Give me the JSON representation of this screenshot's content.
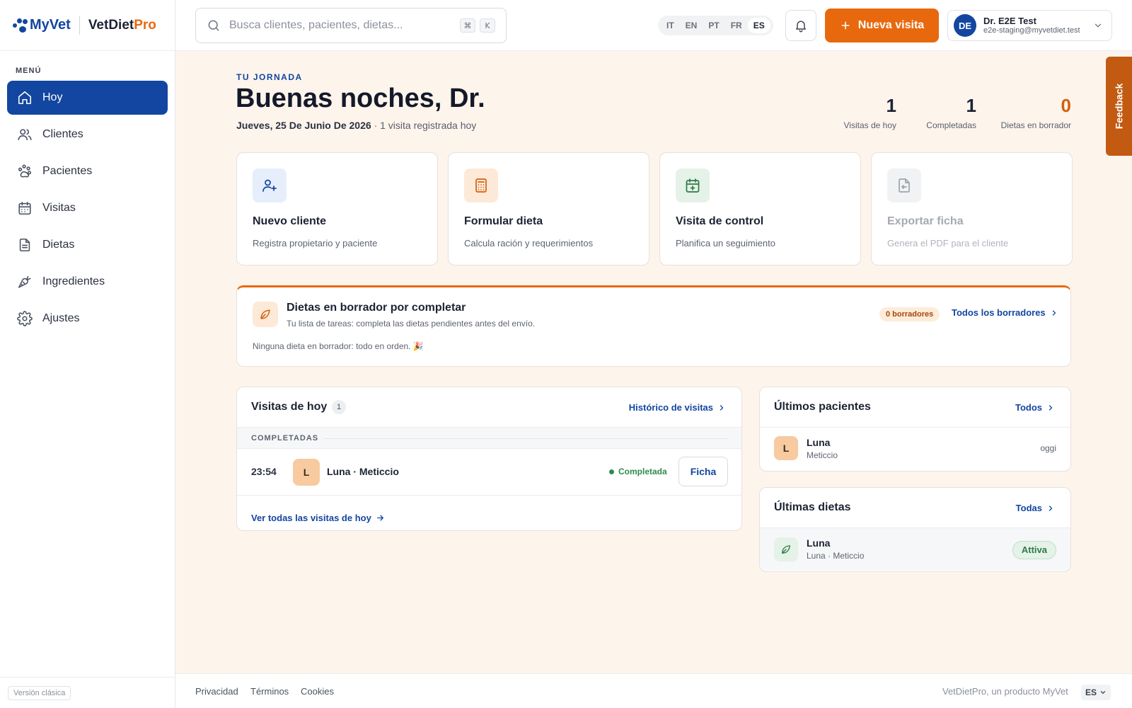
{
  "brand": {
    "name": "MyVet",
    "product_main": "VetDiet",
    "product_accent": "Pro"
  },
  "sidebar": {
    "menu_label": "MENÚ",
    "items": [
      {
        "label": "Hoy",
        "icon": "home-icon",
        "active": true
      },
      {
        "label": "Clientes",
        "icon": "users-icon"
      },
      {
        "label": "Pacientes",
        "icon": "paw-icon"
      },
      {
        "label": "Visitas",
        "icon": "calendar-icon"
      },
      {
        "label": "Dietas",
        "icon": "document-icon"
      },
      {
        "label": "Ingredientes",
        "icon": "carrot-icon"
      },
      {
        "label": "Ajustes",
        "icon": "gear-icon"
      }
    ],
    "classic_version": "Versión clásica"
  },
  "header": {
    "search_placeholder": "Busca clientes, pacientes, dietas...",
    "kbd_cmd": "⌘",
    "kbd_k": "K",
    "languages": [
      "IT",
      "EN",
      "PT",
      "FR",
      "ES"
    ],
    "active_language": "ES",
    "new_visit_label": "Nueva visita",
    "user": {
      "initials": "DE",
      "name": "Dr. E2E Test",
      "email": "e2e-staging@myvetdiet.test"
    }
  },
  "feedback_label": "Feedback",
  "day": {
    "eyebrow": "TU JORNADA",
    "greeting": "Buenas noches, Dr.",
    "date": "Jueves, 25 De Junio De 2026",
    "date_suffix": "· 1 visita registrada hoy",
    "stats": [
      {
        "value": "1",
        "label": "Visitas de hoy"
      },
      {
        "value": "1",
        "label": "Completadas"
      },
      {
        "value": "0",
        "label": "Dietas en borrador",
        "accent": "#d1610f"
      }
    ]
  },
  "actions": [
    {
      "title": "Nuevo cliente",
      "desc": "Registra propietario y paciente",
      "icon": "user-plus-icon"
    },
    {
      "title": "Formular dieta",
      "desc": "Calcula ración y requerimientos",
      "icon": "calculator-icon"
    },
    {
      "title": "Visita de control",
      "desc": "Planifica un seguimiento",
      "icon": "calendar-plus-icon"
    },
    {
      "title": "Exportar ficha",
      "desc": "Genera el PDF para el cliente",
      "icon": "file-export-icon",
      "disabled": true
    }
  ],
  "drafts": {
    "title": "Dietas en borrador por completar",
    "subtitle": "Tu lista de tareas: completa las dietas pendientes antes del envío.",
    "badge": "0 borradores",
    "link": "Todos los borradores",
    "empty": "Ninguna dieta en borrador: todo en orden. 🎉"
  },
  "visits": {
    "title": "Visitas de hoy",
    "count": "1",
    "history_link": "Histórico de visitas",
    "section": "COMPLETADAS",
    "rows": [
      {
        "time": "23:54",
        "initial": "L",
        "name": "Luna · Meticcio",
        "status": "Completada",
        "action": "Ficha"
      }
    ],
    "footer_link": "Ver todas las visitas de hoy"
  },
  "patients": {
    "title": "Últimos pacientes",
    "link": "Todos",
    "rows": [
      {
        "initial": "L",
        "name": "Luna",
        "breed": "Meticcio",
        "meta": "oggi"
      }
    ]
  },
  "diets": {
    "title": "Últimas dietas",
    "link": "Todas",
    "rows": [
      {
        "name": "Luna",
        "sub": "Luna · Meticcio",
        "status": "Attiva"
      }
    ]
  },
  "footer": {
    "links": [
      "Privacidad",
      "Términos",
      "Cookies"
    ],
    "brand_text": "VetDietPro, un producto MyVet",
    "lang": "ES"
  },
  "colors": {
    "primary": "#1346a0",
    "accent": "#e8690d",
    "success": "#2f8a4e",
    "background": "#fdf4ec"
  }
}
